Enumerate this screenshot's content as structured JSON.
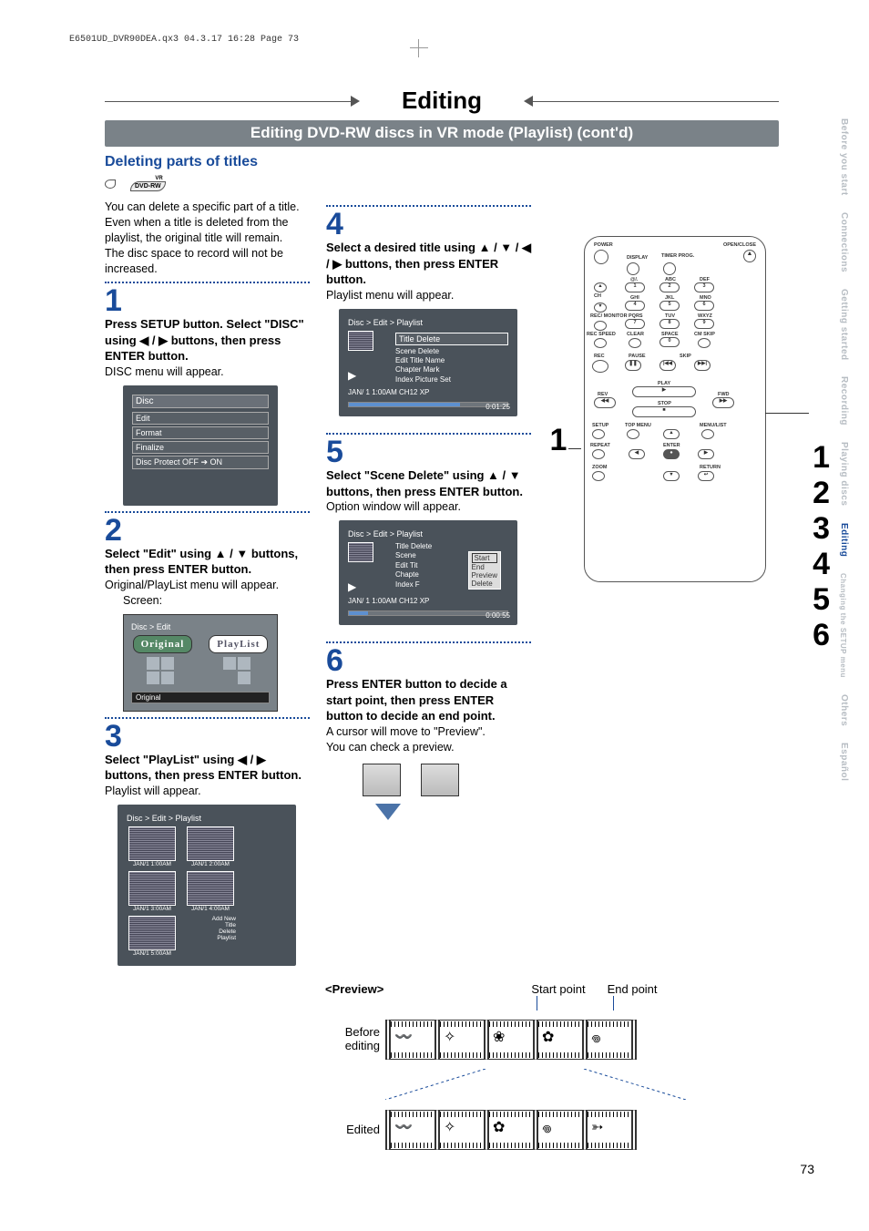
{
  "header_line": "E6501UD_DVR90DEA.qx3  04.3.17  16:28  Page 73",
  "chapter_title": "Editing",
  "section_banner": "Editing DVD-RW discs in VR mode (Playlist) (cont'd)",
  "subtitle": "Deleting parts of titles",
  "disc_badge": "DVD-RW",
  "intro_paragraphs": [
    "You can delete a specific part of a title.",
    "Even when a title is deleted from the playlist, the original title will remain.",
    "The disc space to record will not be increased."
  ],
  "steps": {
    "s1": {
      "num": "1",
      "head": "Press SETUP button. Select \"DISC\" using ◀ / ▶ buttons, then press ENTER button.",
      "tail": "DISC menu will appear."
    },
    "s2": {
      "num": "2",
      "head": "Select \"Edit\" using ▲ / ▼ buttons, then press ENTER button.",
      "tail": "Original/PlayList menu will appear.",
      "screen_label": "Screen:"
    },
    "s3": {
      "num": "3",
      "head": "Select \"PlayList\" using ◀ / ▶ buttons, then press ENTER button.",
      "tail": "Playlist will appear."
    },
    "s4": {
      "num": "4",
      "head": "Select a desired title using ▲ / ▼ / ◀ / ▶ buttons, then press ENTER button.",
      "tail": "Playlist menu will appear."
    },
    "s5": {
      "num": "5",
      "head": "Select \"Scene Delete\" using ▲ / ▼ buttons, then press ENTER button.",
      "tail": "Option window will appear."
    },
    "s6": {
      "num": "6",
      "head": "Press ENTER button to decide a start point, then press ENTER button to decide an end point.",
      "tail1": "A cursor will move to \"Preview\".",
      "tail2": "You can check a preview."
    }
  },
  "disc_menu": {
    "title": "Disc",
    "items": [
      "Edit",
      "Format",
      "Finalize",
      "Disc Protect OFF ➔ ON"
    ]
  },
  "orig_play": {
    "breadcrumb": "Disc > Edit",
    "tab_original": "Original",
    "tab_playlist": "PlayList",
    "footer": "Original"
  },
  "playlist_grid": {
    "breadcrumb": "Disc > Edit > Playlist",
    "cells": [
      "JAN/1  1:00AM",
      "JAN/1  2:00AM",
      "JAN/1  3:00AM",
      "JAN/1  4:00AM",
      "JAN/1  5:00AM"
    ],
    "extra": {
      "l1": "Add New",
      "l2": "Title",
      "l3": "Delete",
      "l4": "Playlist"
    }
  },
  "playlist_menu": {
    "breadcrumb": "Disc > Edit > Playlist",
    "items": [
      "Title Delete",
      "Scene Delete",
      "Edit Title Name",
      "Chapter Mark",
      "Index Picture Set"
    ],
    "bottom": "JAN/ 1   1:00AM   CH12      XP",
    "time": "0:01:25"
  },
  "scene_menu": {
    "breadcrumb": "Disc > Edit > Playlist",
    "left_items": [
      "Title Delete",
      "Scene",
      "Edit Tit",
      "Chapte",
      "Index F"
    ],
    "popup": [
      "Start",
      "End",
      "Preview",
      "Delete"
    ],
    "bottom": "JAN/ 1   1:00AM   CH12      XP",
    "time": "0:00:55"
  },
  "remote": {
    "labels": {
      "power": "POWER",
      "openclose": "OPEN/CLOSE",
      "display": "DISPLAY",
      "timerprog": "TIMER PROG.",
      "at": "@/.",
      "abc": "ABC",
      "def": "DEF",
      "ch": "CH",
      "ghi": "GHI",
      "jkl": "JKL",
      "mno": "MNO",
      "recmon": "REC/ MONITOR",
      "pqrs": "PQRS",
      "tuv": "TUV",
      "wxyz": "WXYZ",
      "recspeed": "REC SPEED",
      "clear": "CLEAR",
      "space": "SPACE",
      "cmskip": "CM SKIP",
      "rec": "REC",
      "pause": "PAUSE",
      "skip": "SKIP",
      "play": "PLAY",
      "rev": "REV",
      "stop": "STOP",
      "fwd": "FWD",
      "setup": "SETUP",
      "topmenu": "TOP MENU",
      "menulist": "MENU/LIST",
      "repeat": "REPEAT",
      "enter": "ENTER",
      "zoom": "ZOOM",
      "return": "RETURN"
    },
    "nums": {
      "n1": "1",
      "n2": "2",
      "n3": "3",
      "n4": "4",
      "n5": "5",
      "n6": "6",
      "n7": "7",
      "n8": "8",
      "n9": "9",
      "n0": "0"
    },
    "triangle_open": "▲",
    "left_callout": "1",
    "right_callouts": [
      "1",
      "2",
      "3",
      "4",
      "5",
      "6"
    ]
  },
  "preview": {
    "heading": "<Preview>",
    "start": "Start point",
    "end": "End point",
    "before": "Before editing",
    "edited": "Edited"
  },
  "side_tabs": [
    "Before you start",
    "Connections",
    "Getting started",
    "Recording",
    "Playing discs",
    "Editing",
    "Changing the SETUP menu",
    "Others",
    "Español"
  ],
  "active_tab_index": 5,
  "page_number": "73"
}
